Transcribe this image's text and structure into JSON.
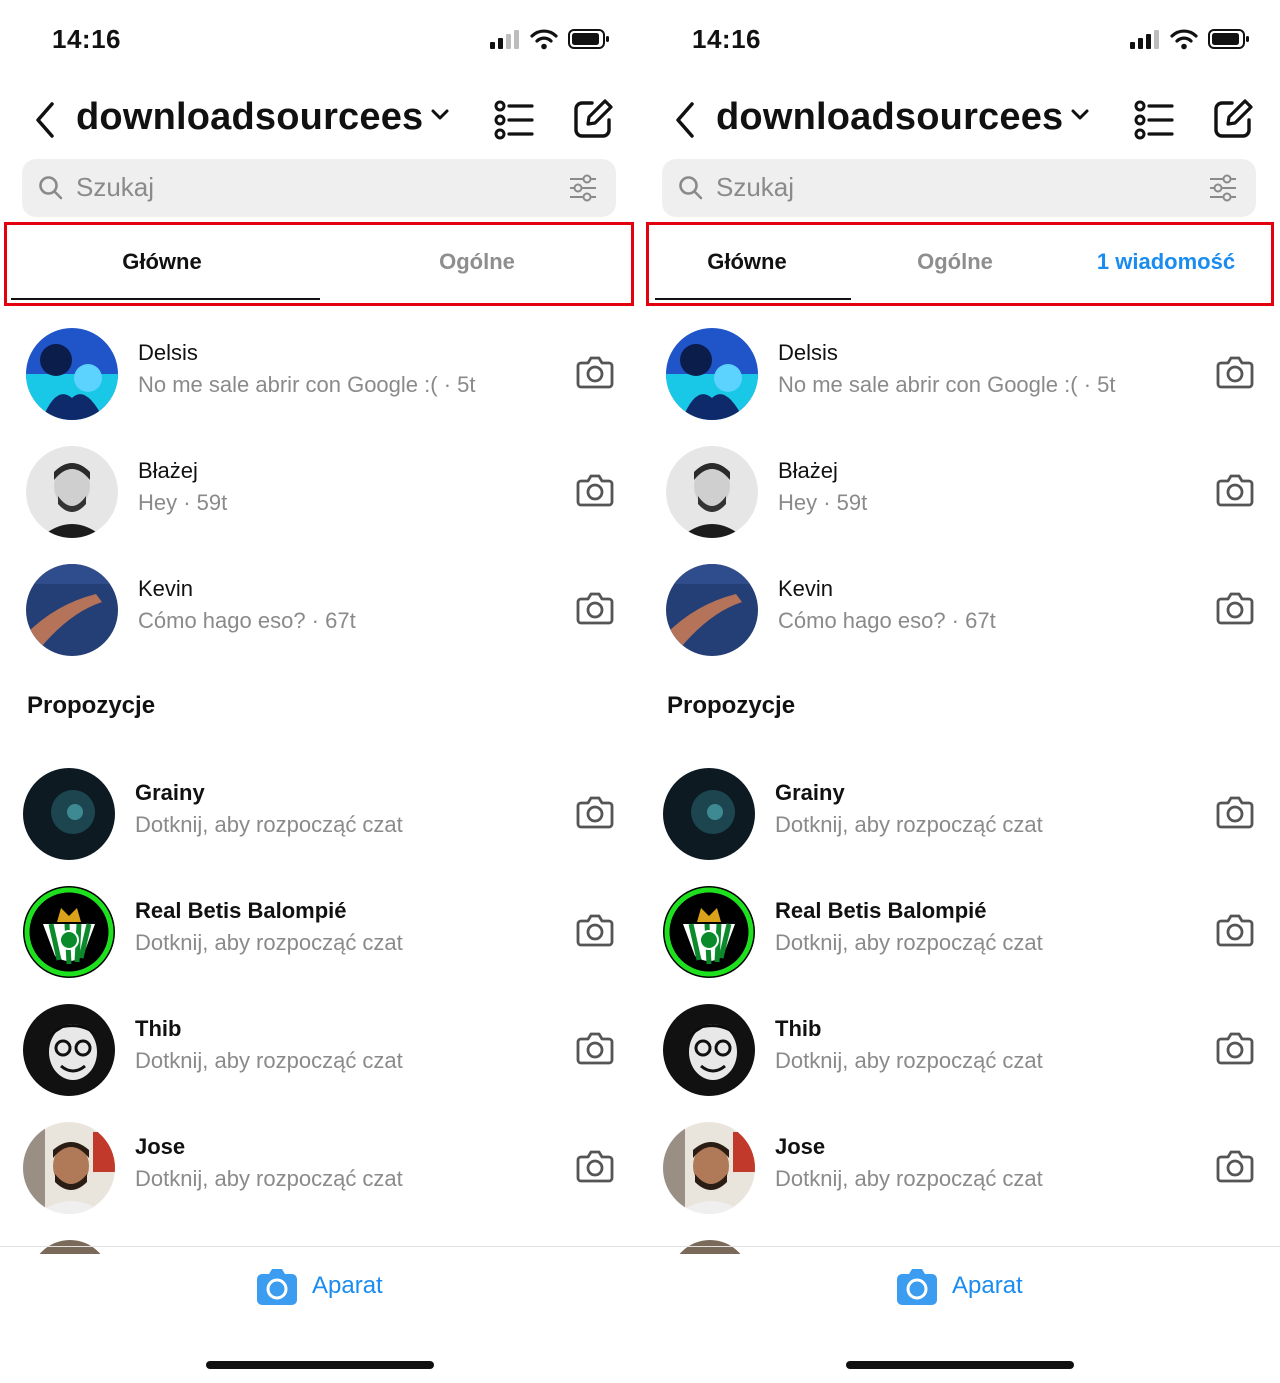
{
  "screens": [
    {
      "status": {
        "time": "14:16"
      },
      "header": {
        "account": "downloadsourcees"
      },
      "search": {
        "placeholder": "Szukaj"
      },
      "tabs": [
        {
          "label": "Główne",
          "active": true
        },
        {
          "label": "Ogólne",
          "active": false
        }
      ],
      "chats": [
        {
          "name": "Delsis",
          "preview": "No me sale abrir con Google :( · 5t"
        },
        {
          "name": "Błażej",
          "preview": "Hey · 59t"
        },
        {
          "name": "Kevin",
          "preview": "Cómo hago eso? · 67t"
        }
      ],
      "suggestions_title": "Propozycje",
      "suggestions": [
        {
          "name": "Grainy",
          "subtitle": "Dotknij, aby rozpocząć czat"
        },
        {
          "name": "Real Betis Balompié",
          "subtitle": "Dotknij, aby rozpocząć czat"
        },
        {
          "name": "Thib",
          "subtitle": "Dotknij, aby rozpocząć czat"
        },
        {
          "name": "Jose",
          "subtitle": "Dotknij, aby rozpocząć czat"
        }
      ],
      "camera_label": "Aparat"
    },
    {
      "status": {
        "time": "14:16"
      },
      "header": {
        "account": "downloadsourcees"
      },
      "search": {
        "placeholder": "Szukaj"
      },
      "tabs": [
        {
          "label": "Główne",
          "active": true
        },
        {
          "label": "Ogólne",
          "active": false
        },
        {
          "label": "1 wiadomość",
          "active": false
        }
      ],
      "chats": [
        {
          "name": "Delsis",
          "preview": "No me sale abrir con Google :( · 5t"
        },
        {
          "name": "Błażej",
          "preview": "Hey · 59t"
        },
        {
          "name": "Kevin",
          "preview": "Cómo hago eso? · 67t"
        }
      ],
      "suggestions_title": "Propozycje",
      "suggestions": [
        {
          "name": "Grainy",
          "subtitle": "Dotknij, aby rozpocząć czat"
        },
        {
          "name": "Real Betis Balompié",
          "subtitle": "Dotknij, aby rozpocząć czat"
        },
        {
          "name": "Thib",
          "subtitle": "Dotknij, aby rozpocząć czat"
        },
        {
          "name": "Jose",
          "subtitle": "Dotknij, aby rozpocząć czat"
        }
      ],
      "camera_label": "Aparat"
    }
  ],
  "colors": {
    "highlight": "#e3000f",
    "accent_blue": "#1a8cf0",
    "muted_text": "#8a8a8a"
  }
}
